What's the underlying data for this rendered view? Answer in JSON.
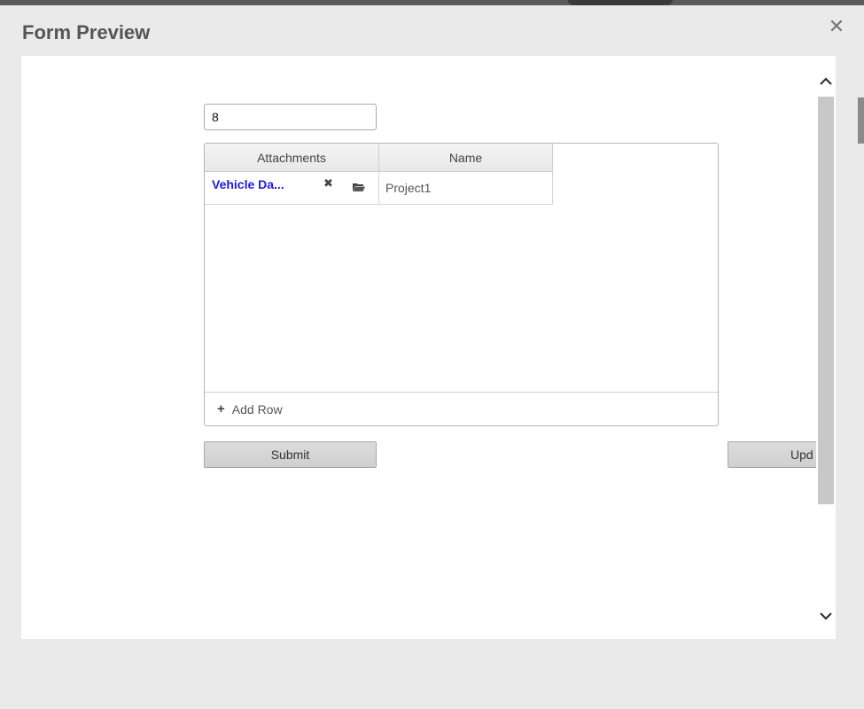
{
  "dialog": {
    "title": "Form Preview",
    "close_glyph": "✕"
  },
  "form": {
    "number_value": "8",
    "grid": {
      "columns": [
        "Attachments",
        "Name"
      ],
      "rows": [
        {
          "attachment": "Vehicle Da...",
          "name": "Project1"
        }
      ],
      "add_row_label": "Add Row"
    },
    "submit_label": "Submit",
    "update_label": "Upd"
  },
  "icons": {
    "remove": "remove-icon",
    "folder": "folder-open-icon",
    "add": "plus-icon",
    "scroll_up": "chevron-up-icon",
    "scroll_down": "chevron-down-icon"
  },
  "colors": {
    "link": "#1b1bdc",
    "title": "#555555",
    "button_bg": "#d6d6d6"
  }
}
